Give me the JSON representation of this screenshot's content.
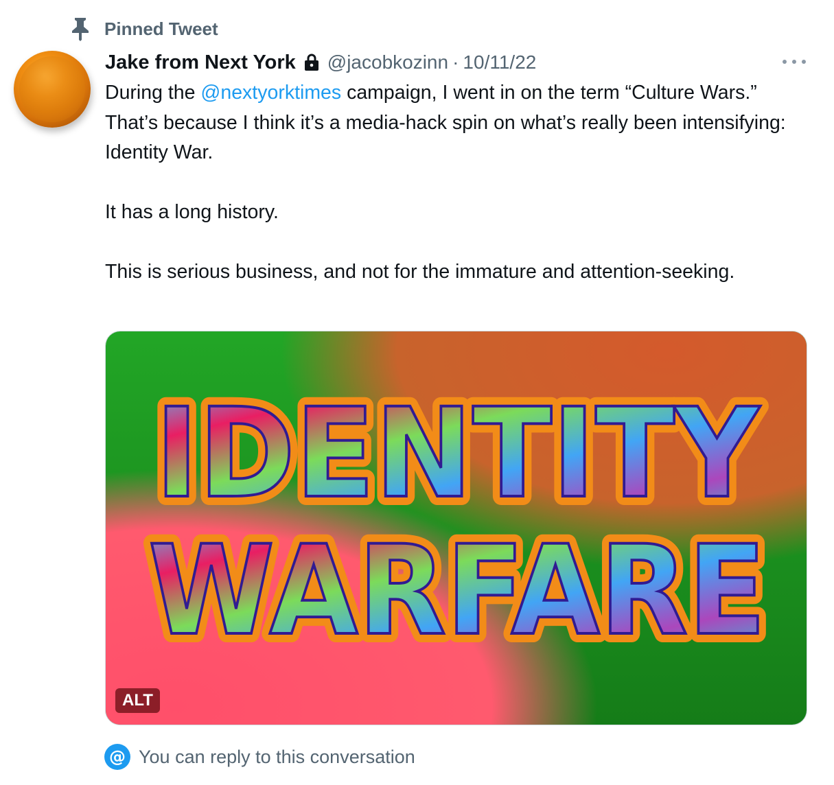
{
  "pinned": {
    "label": "Pinned Tweet",
    "icon": "pin-icon"
  },
  "tweet": {
    "display_name": "Jake from Next York",
    "protected_icon": "lock-icon",
    "handle": "@jacobkozinn",
    "separator": "·",
    "date": "10/11/22",
    "more_icon": "more-icon",
    "text": {
      "line1_prefix": "During the ",
      "mention": "@nextyorktimes",
      "line1_suffix": " campaign, I went in on the term “Culture Wars.” That’s because I think it’s a media-hack spin on what’s really been intensifying: Identity War.",
      "para2": "It has a long history.",
      "para3": "This is serious business, and not for the immature and attention-seeking."
    },
    "media": {
      "title_line1": "IDENTITY",
      "title_line2": "WARFARE",
      "alt_badge": "ALT",
      "colors": {
        "green": "#1ea61e",
        "orange": "#d05a2a",
        "pink": "#ff4f68"
      }
    }
  },
  "reply": {
    "icon": "at-icon",
    "icon_glyph": "@",
    "label": "You can reply to this conversation"
  },
  "colors": {
    "accent": "#1d9bf0",
    "secondary_text": "#536471",
    "primary_text": "#0f1419"
  }
}
